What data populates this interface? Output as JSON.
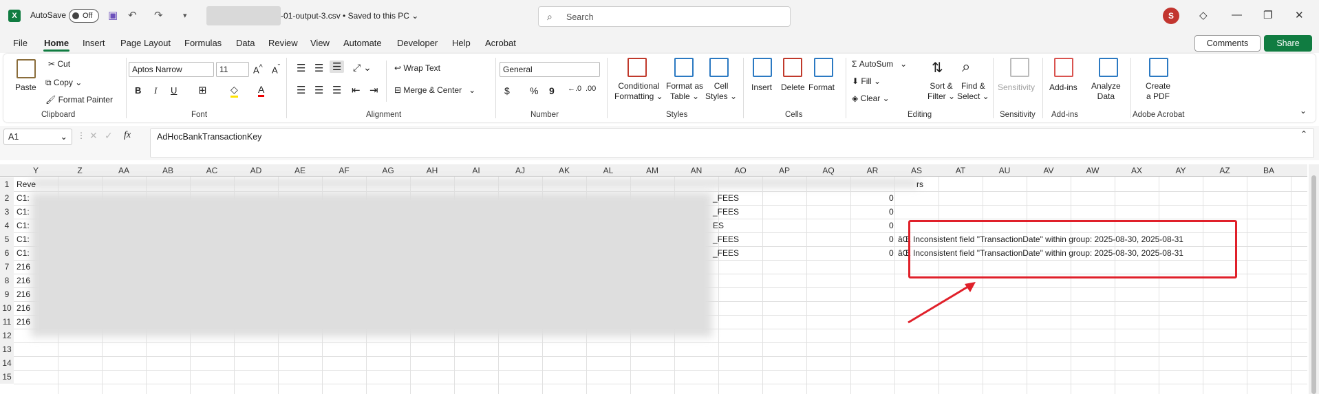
{
  "title_bar": {
    "app_logo": "X",
    "autosave_label": "AutoSave",
    "toggle_state": "Off",
    "filename": "-01-output-3.csv • Saved to this PC ⌄",
    "search_placeholder": "Search",
    "avatar_initial": "S",
    "icons": [
      "save-icon",
      "undo-icon",
      "redo-icon",
      "customize-icon",
      "diamond-icon",
      "minimize-icon",
      "restore-icon",
      "close-icon"
    ]
  },
  "menu": {
    "items": [
      "File",
      "Home",
      "Insert",
      "Page Layout",
      "Formulas",
      "Data",
      "Review",
      "View",
      "Automate",
      "Developer",
      "Help",
      "Acrobat"
    ],
    "active": "Home",
    "comments": "Comments",
    "share": "Share"
  },
  "ribbon": {
    "clipboard": {
      "paste": "Paste",
      "cut": "Cut",
      "copy": "Copy",
      "format_painter": "Format Painter",
      "label": "Clipboard"
    },
    "font": {
      "name": "Aptos Narrow",
      "size": "11",
      "bold": "B",
      "italic": "I",
      "underline": "U",
      "label": "Font"
    },
    "alignment": {
      "wrap": "Wrap Text",
      "merge": "Merge & Center",
      "label": "Alignment"
    },
    "number": {
      "format": "General",
      "currency": "$",
      "percent": "%",
      "comma": "9",
      "label": "Number"
    },
    "styles": {
      "conditional": "Conditional",
      "formatting": "Formatting ⌄",
      "format_as": "Format as",
      "table": "Table ⌄",
      "cell": "Cell",
      "cell_styles": "Styles ⌄",
      "label": "Styles"
    },
    "cells": {
      "insert": "Insert",
      "delete": "Delete",
      "format": "Format",
      "label": "Cells"
    },
    "editing": {
      "autosum": "AutoSum",
      "fill": "Fill ⌄",
      "clear": "Clear ⌄",
      "sort": "Sort &",
      "filter": "Filter ⌄",
      "find": "Find &",
      "select": "Select ⌄",
      "label": "Editing"
    },
    "sensitivity": {
      "btn": "Sensitivity",
      "label": "Sensitivity"
    },
    "addins": {
      "btn": "Add-ins",
      "label": "Add-ins"
    },
    "analyze": {
      "btn1": "Analyze",
      "btn2": "Data"
    },
    "acrobat": {
      "btn1": "Create",
      "btn2": "a PDF",
      "label": "Adobe Acrobat"
    }
  },
  "formula_bar": {
    "name_box": "A1",
    "fx": "fx",
    "content": "AdHocBankTransactionKey"
  },
  "grid": {
    "columns": [
      "Y",
      "Z",
      "AA",
      "AB",
      "AC",
      "AD",
      "AE",
      "AF",
      "AG",
      "AH",
      "AI",
      "AJ",
      "AK",
      "AL",
      "AM",
      "AN",
      "AO",
      "AP",
      "AQ",
      "AR",
      "AS",
      "AT",
      "AU",
      "AV",
      "AW",
      "AX",
      "AY",
      "AZ",
      "BA"
    ],
    "rows": [
      "1",
      "2",
      "3",
      "4",
      "5",
      "6",
      "7",
      "8",
      "9",
      "10",
      "11",
      "12",
      "13",
      "14",
      "15"
    ],
    "col_y_cells": [
      "Reve",
      "C1:",
      "C1:",
      "C1:",
      "C1:",
      "C1:",
      "216",
      "216",
      "216",
      "216",
      "216"
    ],
    "col_an_cells": [
      "",
      "_FEES",
      "_FEES",
      "ES",
      "_FEES",
      "_FEES"
    ],
    "col_ar_cells": [
      "",
      "0",
      "0",
      "0",
      "0",
      "0"
    ],
    "as_row1": "rs",
    "error_rows": [
      "âŒ Inconsistent field \"TransactionDate\" within group: 2025-08-30, 2025-08-31",
      "âŒ Inconsistent field \"TransactionDate\" within group: 2025-08-30, 2025-08-31"
    ]
  }
}
